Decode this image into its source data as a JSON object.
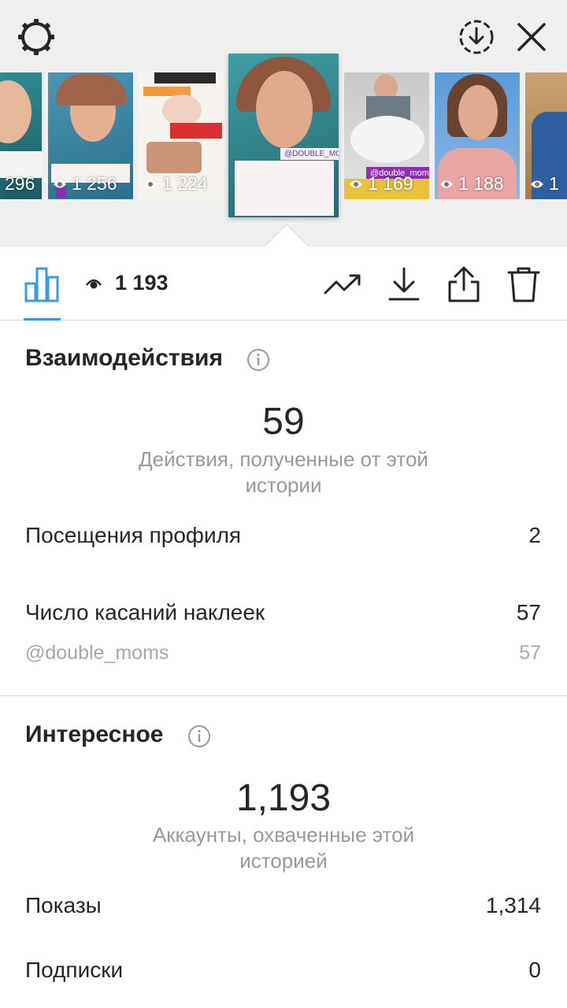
{
  "header": {
    "settings_icon": "gear-icon",
    "download_icon": "download-circle-icon",
    "close_icon": "close-icon"
  },
  "stories": [
    {
      "views": "296",
      "label": "",
      "selected": false
    },
    {
      "views": "1 256",
      "label": "",
      "selected": false
    },
    {
      "views": "1 224",
      "label": "",
      "selected": false
    },
    {
      "views": "",
      "label": "@DOUBLE_MOMS",
      "selected": true
    },
    {
      "views": "1 169",
      "label": "@double_moms",
      "selected": false
    },
    {
      "views": "1 188",
      "label": "",
      "selected": false
    },
    {
      "views": "1",
      "label": "",
      "selected": false
    }
  ],
  "tabbar": {
    "view_count": "1 193",
    "active_tab_color": "#3897f0"
  },
  "interactions": {
    "title": "Взаимодействия",
    "total": "59",
    "caption": "Действия, полученные от этой истории",
    "rows": [
      {
        "label": "Посещения профиля",
        "value": "2"
      },
      {
        "label": "Число касаний наклеек",
        "value": "57"
      }
    ],
    "sub_row": {
      "label": "@double_moms",
      "value": "57"
    }
  },
  "discovery": {
    "title": "Интересное",
    "total": "1,193",
    "caption": "Аккаунты, охваченные этой историей",
    "rows": [
      {
        "label": "Показы",
        "value": "1,314"
      },
      {
        "label": "Подписки",
        "value": "0"
      }
    ]
  }
}
